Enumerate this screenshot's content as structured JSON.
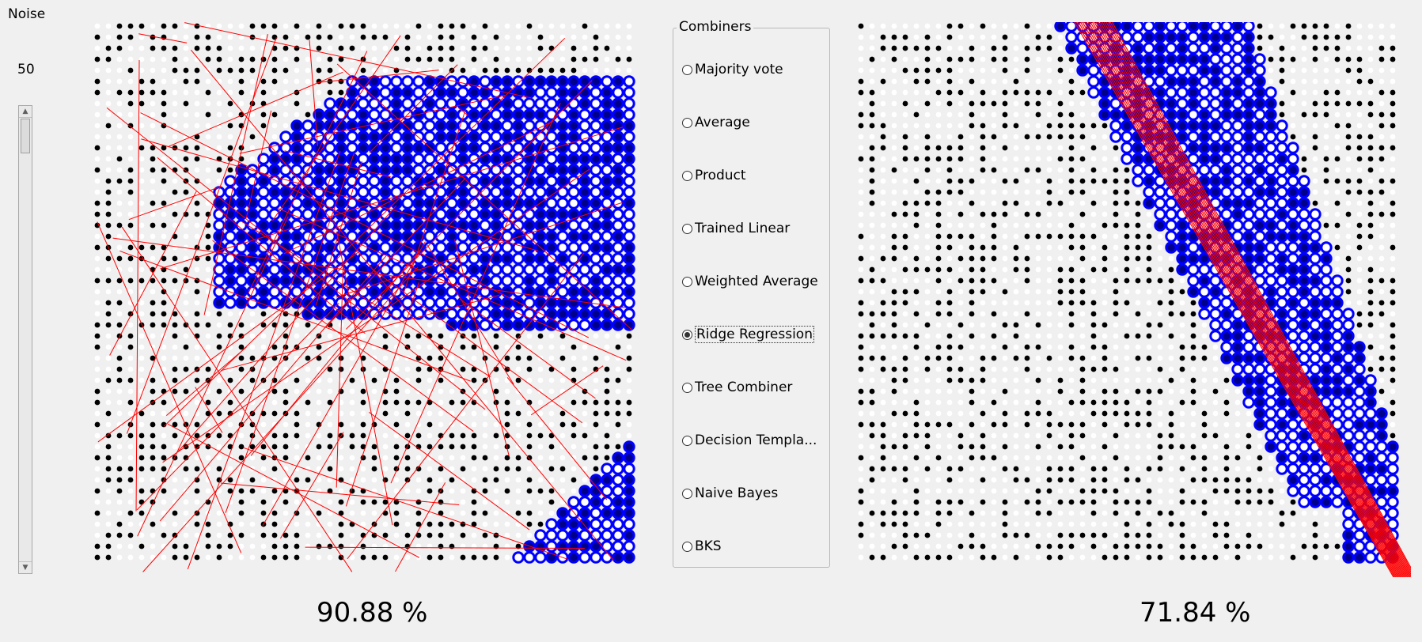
{
  "noise": {
    "title": "Noise",
    "value": "50",
    "level": 50
  },
  "combiners": {
    "title": "Combiners",
    "options": [
      "Majority vote",
      "Average",
      "Product",
      "Trained Linear",
      "Weighted Average",
      "Ridge Regression",
      "Tree Combiner",
      "Decision Templa...",
      "Naive Bayes",
      "BKS"
    ],
    "selected_index": 5
  },
  "left_plot": {
    "accuracy": "90.88 %"
  },
  "right_plot": {
    "accuracy": "71.84 %"
  },
  "colors": {
    "background": "#f0f0f0",
    "class_a_dot": "#000000",
    "class_b_dot": "#ffffff",
    "region_fill": "#0000ff",
    "boundary_line": "#ff0000"
  }
}
